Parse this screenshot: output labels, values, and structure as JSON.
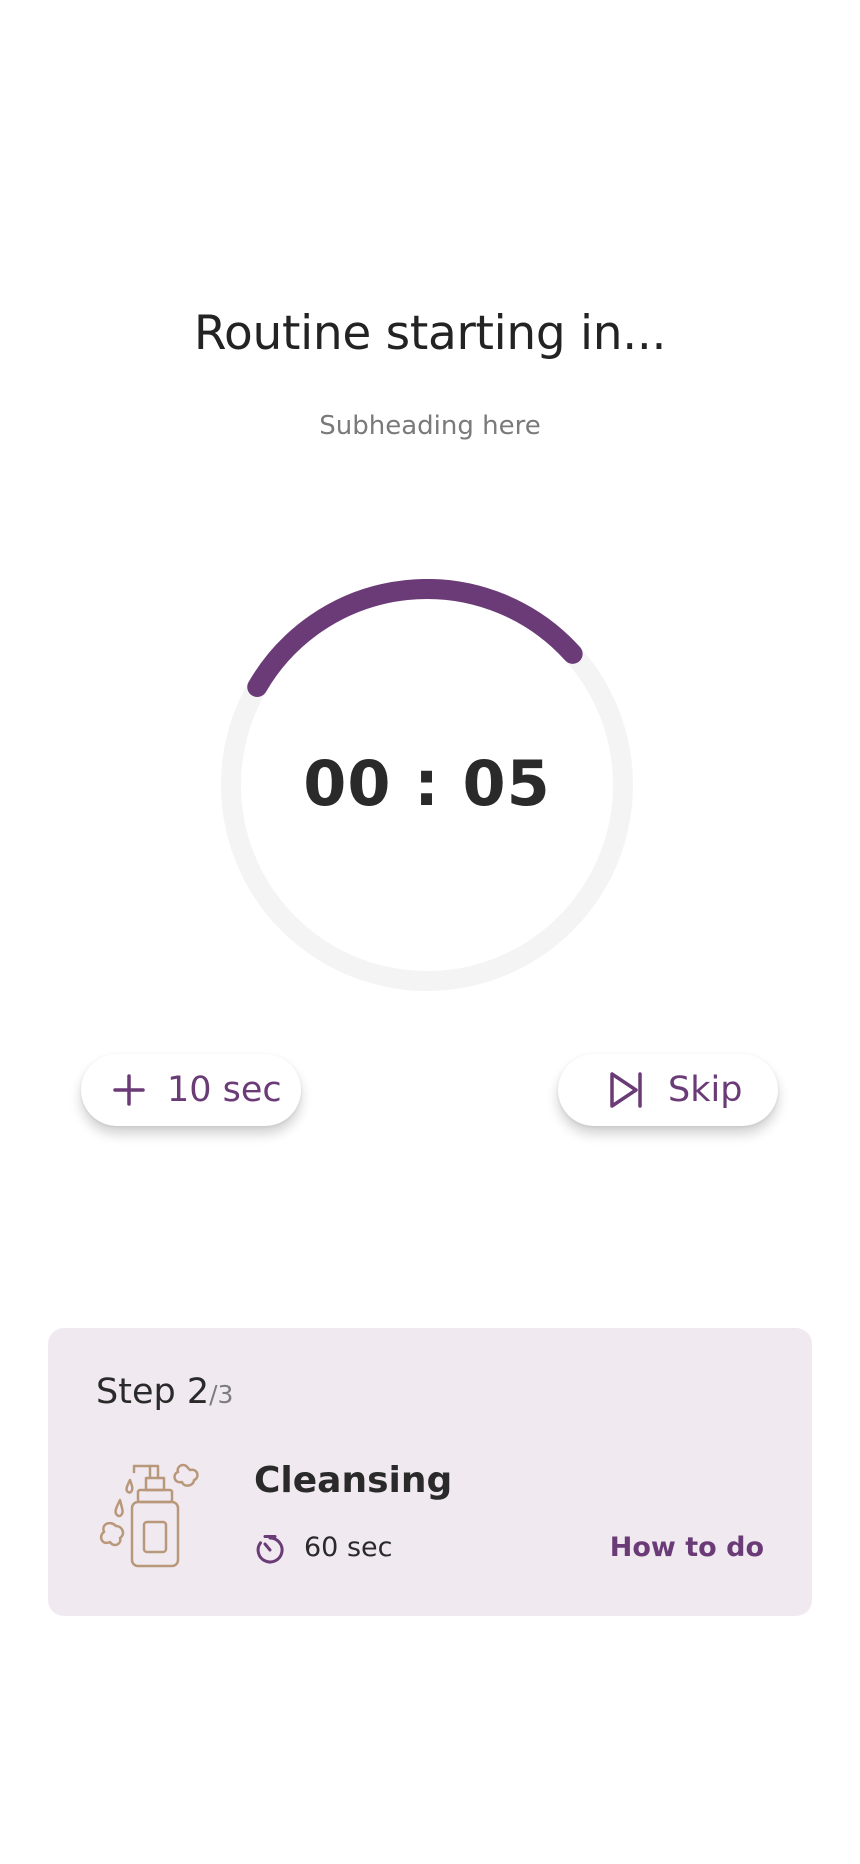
{
  "header": {
    "title": "Routine starting in...",
    "subtitle": "Subheading here"
  },
  "countdown": {
    "display": "00 : 05",
    "progress_fraction": 0.3,
    "colors": {
      "accent": "#6a3b77",
      "track": "#f4f4f4"
    }
  },
  "actions": {
    "add_time_label": "10 sec",
    "add_time_icon": "plus-icon",
    "skip_label": "Skip",
    "skip_icon": "skip-next-icon"
  },
  "step_card": {
    "step_current": "Step 2",
    "step_total": "/3",
    "name": "Cleansing",
    "duration": "60 sec",
    "duration_icon": "timer-icon",
    "product_icon": "cleanser-bottle-icon",
    "how_to_label": "How to do",
    "background": "#f0eaf0"
  }
}
